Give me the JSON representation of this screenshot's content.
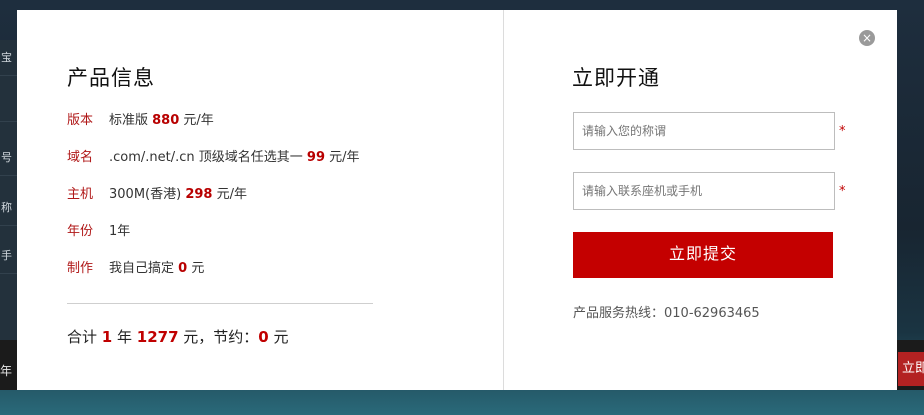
{
  "backdrop": {
    "left_menu": [
      "宝",
      "",
      "号",
      "称",
      "手"
    ],
    "left_bottom_text": "年",
    "right_button_text": "立即"
  },
  "close_icon": "×",
  "product_info": {
    "title": "产品信息",
    "rows": [
      {
        "label": "版本",
        "prefix": "标准版 ",
        "num": "880",
        "suffix": " 元/年"
      },
      {
        "label": "域名",
        "prefix": ".com/.net/.cn 顶级域名任选其一 ",
        "num": "99",
        "suffix": " 元/年"
      },
      {
        "label": "主机",
        "prefix": "300M(香港) ",
        "num": "298",
        "suffix": " 元/年"
      },
      {
        "label": "年份",
        "prefix": "1年",
        "num": "",
        "suffix": ""
      },
      {
        "label": "制作",
        "prefix": "我自己搞定 ",
        "num": "0",
        "suffix": " 元"
      }
    ],
    "total": {
      "t1": "合计 ",
      "years": "1",
      "t2": " 年 ",
      "amount": "1277",
      "t3": " 元，节约：",
      "saved": "0",
      "t4": " 元"
    }
  },
  "signup": {
    "title": "立即开通",
    "name_placeholder": "请输入您的称谓",
    "phone_placeholder": "请输入联系座机或手机",
    "required_mark": "*",
    "submit_label": "立即提交",
    "hotline": "产品服务热线：010-62963465"
  }
}
